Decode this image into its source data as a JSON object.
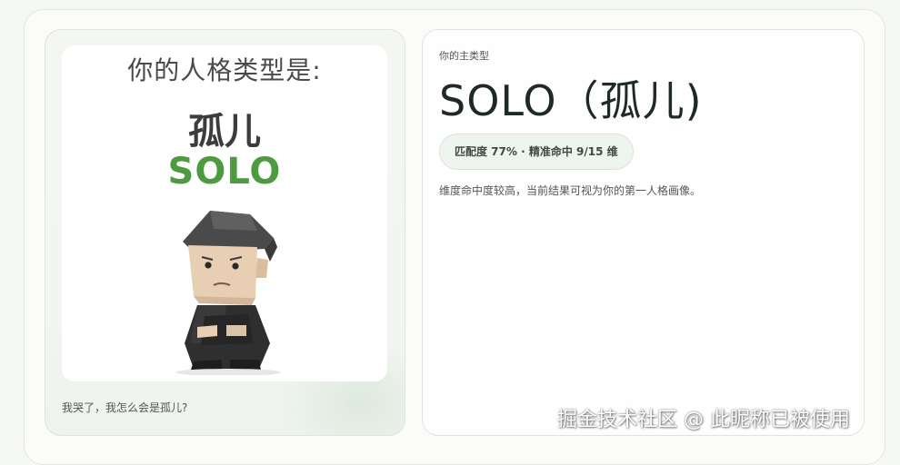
{
  "left_card": {
    "image": {
      "heading": "你的人格类型是:",
      "cn_name": "孤儿",
      "en_name": "SOLO",
      "name_color": "#4d9a3f"
    },
    "caption": "我哭了，我怎么会是孤儿?"
  },
  "right_card": {
    "label": "你的主类型",
    "title": "SOLO（孤儿)",
    "badge": "匹配度 77% · 精准命中 9/15 维",
    "description": "维度命中度较高，当前结果可视为你的第一人格画像。"
  },
  "watermark": "掘金技术社区 @ 此昵称已被使用"
}
